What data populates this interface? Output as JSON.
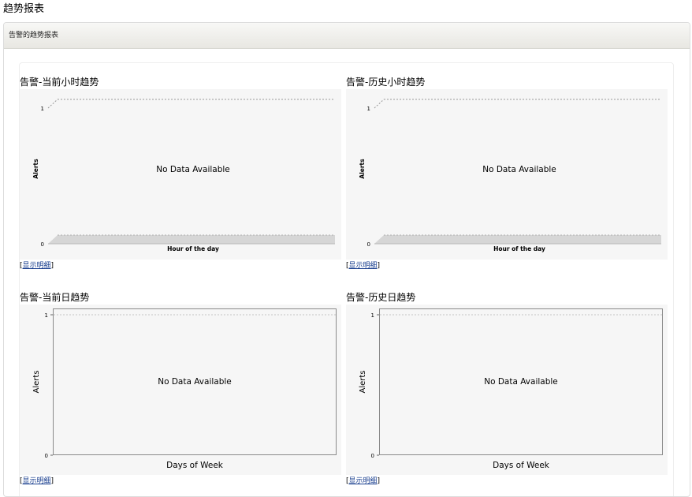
{
  "page": {
    "title": "趋势报表"
  },
  "panel": {
    "header_label": "告警的趋势报表"
  },
  "details_link_label": "显示明细",
  "chart_data": [
    {
      "type": "area",
      "title": "告警-当前小时趋势",
      "xlabel": "Hour of the day",
      "ylabel": "Alerts",
      "yticks": [
        "1",
        "0"
      ],
      "ylim": [
        0,
        1
      ],
      "message": "No Data Available",
      "series": []
    },
    {
      "type": "area",
      "title": "告警-历史小时趋势",
      "xlabel": "Hour of the day",
      "ylabel": "Alerts",
      "yticks": [
        "1",
        "0"
      ],
      "ylim": [
        0,
        1
      ],
      "message": "No Data Available",
      "series": []
    },
    {
      "type": "bar",
      "title": "告警-当前日趋势",
      "xlabel": "Days of Week",
      "ylabel": "Alerts",
      "yticks": [
        "1",
        "0"
      ],
      "ylim": [
        0,
        1
      ],
      "message": "No Data Available",
      "series": []
    },
    {
      "type": "bar",
      "title": "告警-历史日趋势",
      "xlabel": "Days of Week",
      "ylabel": "Alerts",
      "yticks": [
        "1",
        "0"
      ],
      "ylim": [
        0,
        1
      ],
      "message": "No Data Available",
      "series": []
    }
  ],
  "colors": {
    "plot_background": "#f6f6f6",
    "plot_border": "#8a8a8a",
    "floor_fill": "#d6d6d6",
    "link": "#1a3f8f"
  }
}
